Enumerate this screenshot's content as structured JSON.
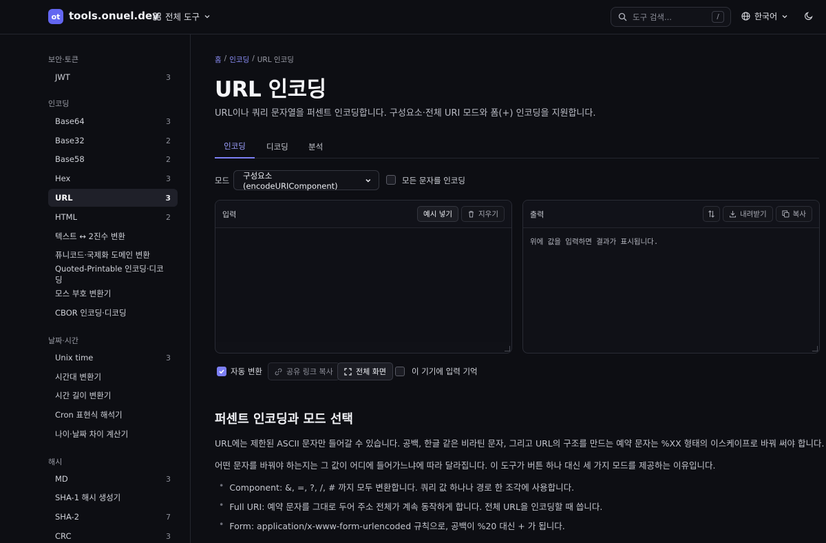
{
  "header": {
    "logo_text": "ot",
    "site_name": "tools.onuel.dev",
    "all_tools_label": "전체 도구",
    "search_placeholder": "도구 검색...",
    "search_shortcut": "/",
    "language": "한국어",
    "accent": "#6366f1"
  },
  "sidebar": {
    "groups": [
      {
        "label": "보안·토큰"
      },
      {
        "label": "인코딩"
      },
      {
        "label": "날짜·시간"
      },
      {
        "label": "해시"
      }
    ],
    "items": [
      {
        "label": "JWT",
        "count": "3"
      },
      {
        "label": "Base64",
        "count": "3"
      },
      {
        "label": "Base32",
        "count": "2"
      },
      {
        "label": "Base58",
        "count": "2"
      },
      {
        "label": "Hex",
        "count": "3"
      },
      {
        "label": "URL",
        "count": "3"
      },
      {
        "label": "HTML",
        "count": "2"
      },
      {
        "label": "텍스트 ↔ 2진수 변환",
        "count": ""
      },
      {
        "label": "퓨니코드·국제화 도메인 변환",
        "count": ""
      },
      {
        "label": "Quoted-Printable 인코딩·디코딩",
        "count": ""
      },
      {
        "label": "모스 부호 변환기",
        "count": ""
      },
      {
        "label": "CBOR 인코딩·디코딩",
        "count": ""
      },
      {
        "label": "Unix time",
        "count": "3"
      },
      {
        "label": "시간대 변환기",
        "count": ""
      },
      {
        "label": "시간 길이 변환기",
        "count": ""
      },
      {
        "label": "Cron 표현식 해석기",
        "count": ""
      },
      {
        "label": "나이·날짜 차이 계산기",
        "count": ""
      },
      {
        "label": "MD",
        "count": "3"
      },
      {
        "label": "SHA-1 해시 생성기",
        "count": ""
      },
      {
        "label": "SHA-2",
        "count": "7"
      },
      {
        "label": "CRC",
        "count": "3"
      }
    ]
  },
  "breadcrumb": {
    "home": "홈",
    "sep1": "/",
    "category": "인코딩",
    "sep2": "/",
    "current": "URL 인코딩"
  },
  "page": {
    "title": "URL 인코딩",
    "description": "URL이나 쿼리 문자열을 퍼센트 인코딩합니다. 구성요소·전체 URI 모드와 폼(+) 인코딩을 지원합니다."
  },
  "tabs": [
    {
      "label": "인코딩"
    },
    {
      "label": "디코딩"
    },
    {
      "label": "분석"
    }
  ],
  "mode": {
    "label": "모드",
    "selected": "구성요소 (encodeURIComponent)",
    "encode_all_label": "모든 문자를 인코딩",
    "encode_all_checked": false
  },
  "input_panel": {
    "title": "입력",
    "sample_label": "예시 넣기",
    "clear_label": "지우기",
    "value": ""
  },
  "output_panel": {
    "title": "출력",
    "download_label": "내려받기",
    "copy_label": "복사",
    "placeholder": "위에 값을 입력하면 결과가 표시됩니다."
  },
  "controls": {
    "auto_convert_label": "자동 변환",
    "auto_convert_checked": true,
    "share_link_label": "공유 링크 복사",
    "fullscreen_label": "전체 화면",
    "remember_label": "이 기기에 입력 기억",
    "remember_checked": false
  },
  "content": {
    "section_title": "퍼센트 인코딩과 모드 선택",
    "para1": "URL에는 제한된 ASCII 문자만 들어갈 수 있습니다. 공백, 한글 같은 비라틴 문자, 그리고 URL의 구조를 만드는 예약 문자는 %XX 형태의 이스케이프로 바꿔 써야 합니다.",
    "para2": "어떤 문자를 바꿔야 하는지는 그 값이 어디에 들어가느냐에 따라 달라집니다. 이 도구가 버튼 하나 대신 세 가지 모드를 제공하는 이유입니다.",
    "bullets": [
      "Component: &, =, ?, /, # 까지 모두 변환합니다. 쿼리 값 하나나 경로 한 조각에 사용합니다.",
      "Full URI: 예약 문자를 그대로 두어 주소 전체가 계속 동작하게 합니다. 전체 URL을 인코딩할 때 씁니다.",
      "Form: application/x-www-form-urlencoded 규칙으로, 공백이 %20 대신 + 가 됩니다."
    ]
  }
}
